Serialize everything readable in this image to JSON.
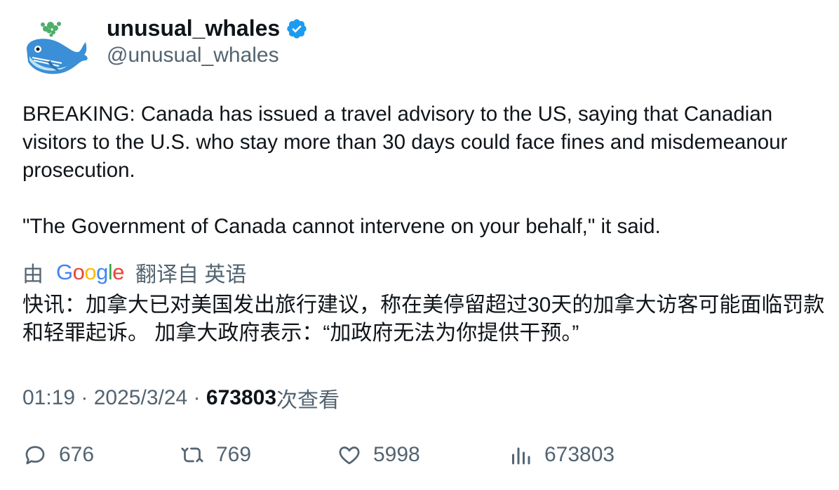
{
  "author": {
    "display_name": "unusual_whales",
    "handle": "@unusual_whales",
    "avatar_icon": "whale-avatar-icon",
    "verified_icon": "verified-badge-icon",
    "verified_color": "#1d9bf0"
  },
  "tweet": {
    "paragraph_1": "BREAKING: Canada has issued a travel advisory to the US, saying that Canadian visitors to the U.S. who stay more than 30 days could face fines and misdemeanour prosecution.",
    "paragraph_2": "\"The Government of Canada cannot intervene on your behalf,\" it said."
  },
  "translation": {
    "prefix": "由",
    "provider": "Google",
    "suffix": "翻译自 英语",
    "text": "快讯：加拿大已对美国发出旅行建议，称在美停留超过30天的加拿大访客可能面临罚款和轻罪起诉。 加拿大政府表示：“加政府无法为你提供干预。”"
  },
  "meta": {
    "time": "01:19",
    "separator": " · ",
    "date": "2025/3/24",
    "views_count": "673803",
    "views_label": "次查看"
  },
  "actions": {
    "replies": "676",
    "retweets": "769",
    "likes": "5998",
    "views": "673803"
  }
}
